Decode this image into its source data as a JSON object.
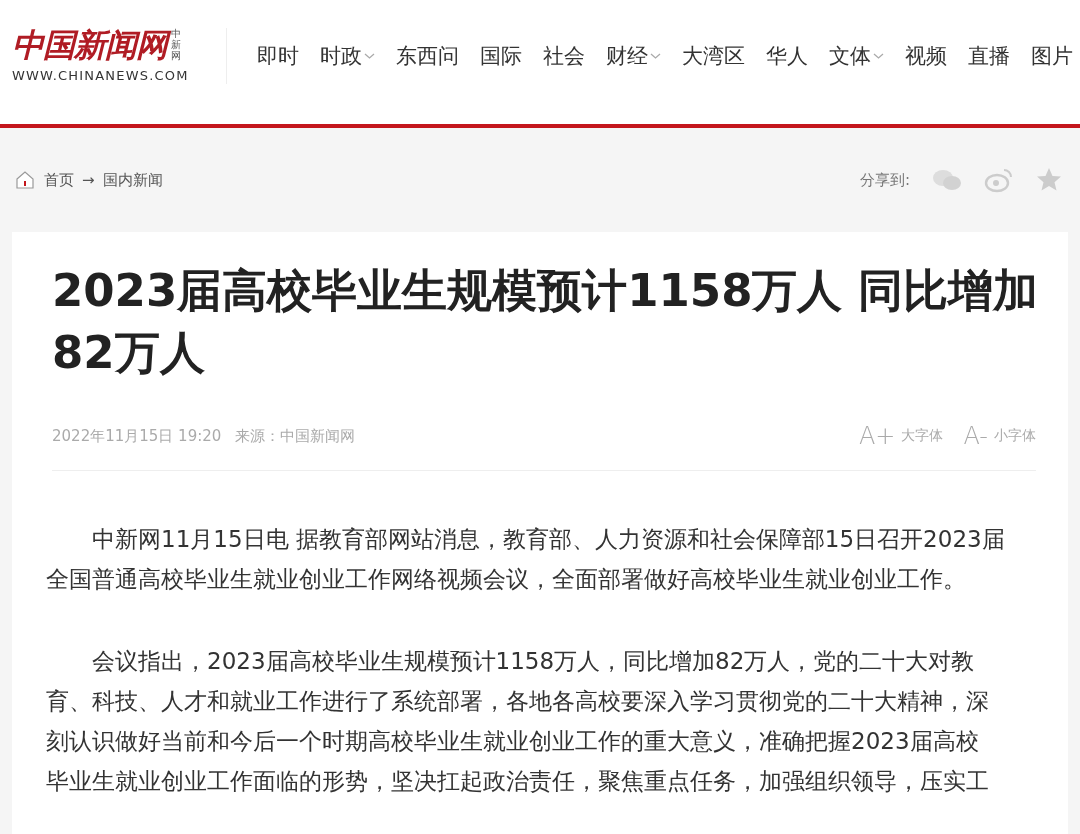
{
  "header": {
    "logo": {
      "name": "中国新闻网",
      "short": "中新网",
      "url": "WWW.CHINANEWS.COM"
    },
    "nav": [
      {
        "label": "即时",
        "has_menu": false
      },
      {
        "label": "时政",
        "has_menu": true
      },
      {
        "label": "东西问",
        "has_menu": false
      },
      {
        "label": "国际",
        "has_menu": false
      },
      {
        "label": "社会",
        "has_menu": false
      },
      {
        "label": "财经",
        "has_menu": true
      },
      {
        "label": "大湾区",
        "has_menu": false
      },
      {
        "label": "华人",
        "has_menu": false
      },
      {
        "label": "文体",
        "has_menu": true
      },
      {
        "label": "视频",
        "has_menu": false
      },
      {
        "label": "直播",
        "has_menu": false
      },
      {
        "label": "图片",
        "has_menu": false
      }
    ]
  },
  "breadcrumb": {
    "items": [
      "首页",
      "国内新闻"
    ],
    "separator": "→"
  },
  "share": {
    "label": "分享到:"
  },
  "article": {
    "title_lines": [
      "2023届高校毕业生规模预计1158万人 同比增加",
      "82万人"
    ],
    "date": "2022年11月15日 19:20",
    "source": "来源：中国新闻网",
    "font_controls": [
      {
        "glyph": "A+",
        "label": "大字体"
      },
      {
        "glyph": "A-",
        "label": "小字体"
      }
    ],
    "paragraphs": [
      {
        "lines": [
          "中新网11月15日电 据教育部网站消息，教育部、人力资源和社会保障部15日召开2023届",
          "全国普通高校毕业生就业创业工作网络视频会议，全面部署做好高校毕业生就业创业工作。"
        ]
      },
      {
        "lines": [
          "会议指出，2023届高校毕业生规模预计1158万人，同比增加82万人，党的二十大对教",
          "育、科技、人才和就业工作进行了系统部署，各地各高校要深入学习贯彻党的二十大精神，深",
          "刻认识做好当前和今后一个时期高校毕业生就业创业工作的重大意义，准确把握2023届高校",
          "毕业生就业创业工作面临的形势，坚决扛起政治责任，聚焦重点任务，加强组织领导，压实工"
        ]
      }
    ]
  }
}
